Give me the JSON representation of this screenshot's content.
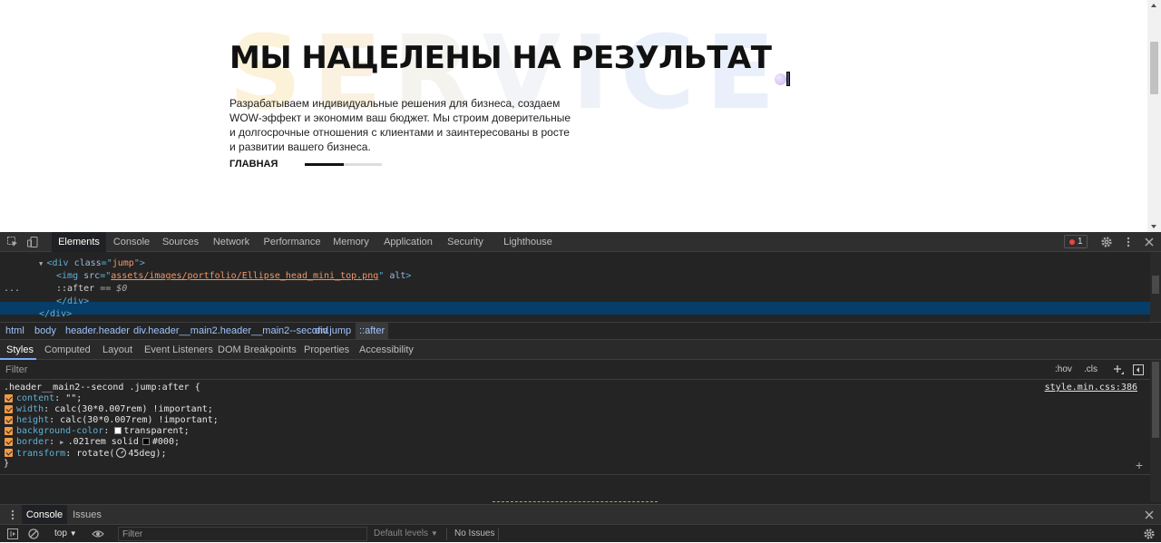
{
  "page": {
    "background_word": [
      "S",
      "E",
      "R",
      "V",
      "I",
      "C",
      "E"
    ],
    "title": "МЫ НАЦЕЛЕНЫ НА РЕЗУЛЬТАТ",
    "description": "Разрабатываем индивидуальные решения для бизнеса, создаем WOW-эффект и экономим ваш бюджет. Мы строим доверительные и долгосрочные отношения с клиентами и заинтересованы в росте и развитии вашего бизнеса.",
    "nav_label": "ГЛАВНАЯ",
    "slider_progress": 0.5
  },
  "devtools": {
    "tabs": [
      {
        "label": "Elements",
        "active": true
      },
      {
        "label": "Console"
      },
      {
        "label": "Sources"
      },
      {
        "label": "Network"
      },
      {
        "label": "Performance"
      },
      {
        "label": "Memory"
      },
      {
        "label": "Application"
      },
      {
        "label": "Security"
      },
      {
        "label": "Lighthouse"
      }
    ],
    "error_count": "1",
    "dom": {
      "jump_open": "<div class=\"jump\">",
      "img_src": "assets/images/portfolio/Ellipse_head_mini_top.png",
      "after_text": "::after",
      "after_eq": "== $0",
      "div_close": "</div>",
      "div_close_outer": "</div>",
      "gutter_dots": "..."
    },
    "breadcrumbs": [
      "html",
      "body",
      "header.header",
      "div.header__main2.header__main2--second",
      "div.jump",
      "::after"
    ],
    "sub_tabs": [
      "Styles",
      "Computed",
      "Layout",
      "Event Listeners",
      "DOM Breakpoints",
      "Properties",
      "Accessibility"
    ],
    "filter_placeholder": "Filter",
    "filter_hov": ":hov",
    "filter_cls": ".cls",
    "rule": {
      "selector": ".header__main2--second .jump:after {",
      "source": "style.min.css:386",
      "content_prop": "content",
      "content_val": "\"\";",
      "width_prop": "width",
      "width_val": "calc(30*0.007rem) !important;",
      "height_prop": "height",
      "height_val": "calc(30*0.007rem) !important;",
      "bg_prop": "background-color",
      "bg_val": "transparent;",
      "border_prop": "border",
      "border_val_a": ".021rem solid",
      "border_val_b": "#000;",
      "transform_prop": "transform",
      "transform_val_a": "rotate(",
      "transform_val_b": "45deg);",
      "close": "}"
    },
    "drawer": {
      "tabs": [
        {
          "label": "Console",
          "active": true
        },
        {
          "label": "Issues"
        }
      ],
      "context": "top",
      "filter_placeholder": "Filter",
      "levels": "Default levels",
      "issues": "No Issues"
    }
  }
}
